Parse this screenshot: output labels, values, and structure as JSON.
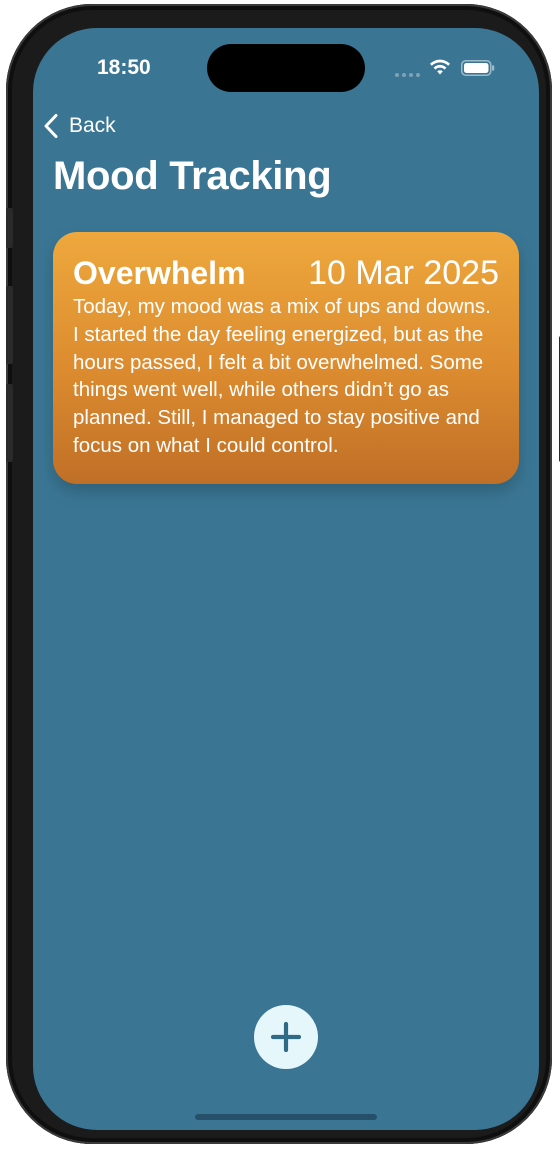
{
  "status_bar": {
    "time": "18:50"
  },
  "nav": {
    "back_label": "Back",
    "title": "Mood Tracking"
  },
  "entries": [
    {
      "mood": "Overwhelm",
      "date": "10 Mar 2025",
      "text": "Today, my mood was a mix of ups and downs. I started the day feeling energized, but as the hours passed, I felt a bit overwhelmed. Some things went well, while others didn’t go as planned. Still, I managed to stay positive and focus on what I could control."
    }
  ],
  "icons": {
    "back": "chevron-left-icon",
    "add": "plus-icon",
    "wifi": "wifi-icon",
    "battery": "battery-icon",
    "signal": "signal-icon"
  },
  "colors": {
    "background": "#3a7694",
    "card_top": "#eea83d",
    "card_bottom": "#c06f27",
    "add_button": "#e6f7fb",
    "add_icon": "#2f6b86"
  }
}
